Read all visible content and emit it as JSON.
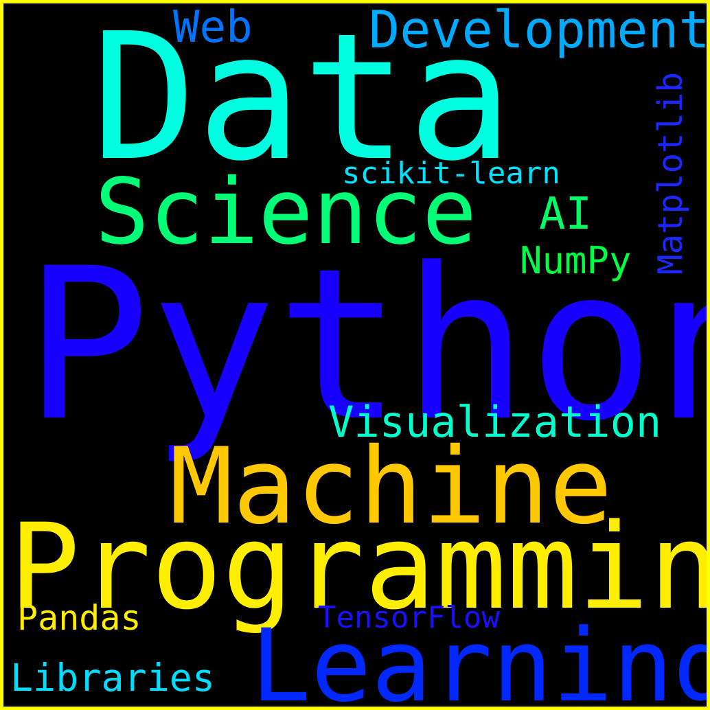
{
  "words": [
    {
      "text": "Python",
      "color": "#1800ff"
    },
    {
      "text": "Data",
      "color": "#00ffe0"
    },
    {
      "text": "Programming",
      "color": "#ffee00"
    },
    {
      "text": "Machine",
      "color": "#ffc800"
    },
    {
      "text": "Learning",
      "color": "#0028ff"
    },
    {
      "text": "Science",
      "color": "#00ff77"
    },
    {
      "text": "Development",
      "color": "#00aaff"
    },
    {
      "text": "Visualization",
      "color": "#00ffcc"
    },
    {
      "text": "Web",
      "color": "#0073ff"
    },
    {
      "text": "AI",
      "color": "#00ff66"
    },
    {
      "text": "Libraries",
      "color": "#00ddff"
    },
    {
      "text": "Pandas",
      "color": "#ffee00"
    },
    {
      "text": "NumPy",
      "color": "#00ff44"
    },
    {
      "text": "scikit-learn",
      "color": "#00e5ff"
    },
    {
      "text": "TensorFlow",
      "color": "#1a10ff"
    },
    {
      "text": "Matplotlib",
      "color": "#1a28ff"
    }
  ],
  "border_color": "#ffff00",
  "background_color": "#000000"
}
